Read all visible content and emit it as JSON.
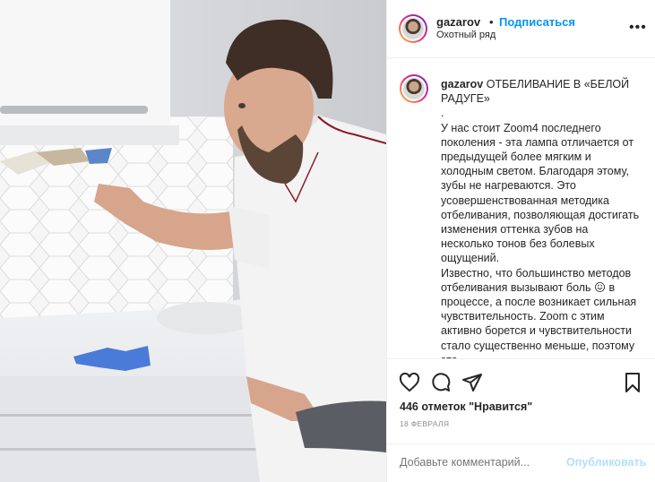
{
  "header": {
    "username": "gazarov",
    "separator": "•",
    "follow_label": "Подписаться",
    "location": "Охотный ряд",
    "more_icon": "ellipsis-icon"
  },
  "caption": {
    "username": "gazarov",
    "text": "ОТБЕЛИВАНИЕ В «БЕЛОЙ РАДУГЕ»\n.\nУ нас стоит Zoom4 последнего поколения - эта лампа отличается от предыдущей более мягким и холодным светом. Благодаря этому, зубы не нагреваются. Это усовершенствованная методика отбеливания, позволяющая достигать изменения оттенка зубов на несколько тонов без болевых ощущений.\nИзвестно, что большинство методов отбеливания вызывают боль 😖 в процессе, а после возникает сильная чувствительность. Zoom с этим активно борется и чувствительности стало существенно меньше, поэтому эта"
  },
  "actions": {
    "like_icon": "heart-icon",
    "comment_icon": "comment-icon",
    "share_icon": "share-icon",
    "save_icon": "bookmark-icon",
    "likes_text": "446 отметок \"Нравится\"",
    "date": "18 ФЕВРАЛЯ"
  },
  "comment": {
    "placeholder": "Добавьте комментарий...",
    "publish_label": "Опубликовать"
  },
  "colors": {
    "accent": "#0095f6",
    "publish_disabled": "#b2dffc",
    "glove": "#4a7bd8"
  }
}
